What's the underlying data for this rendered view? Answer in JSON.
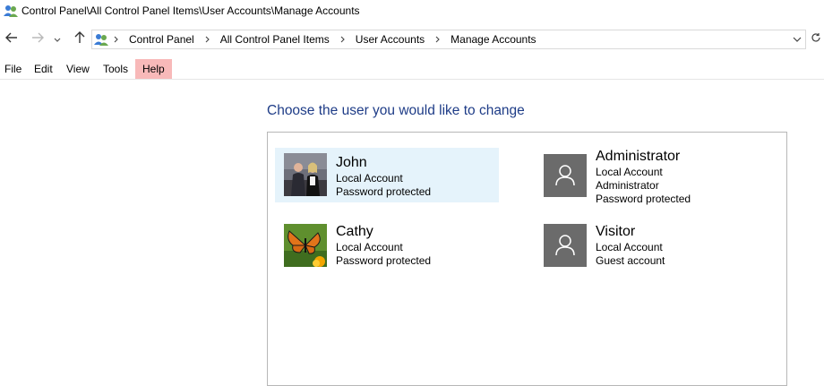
{
  "window": {
    "title": "Control Panel\\All Control Panel Items\\User Accounts\\Manage Accounts",
    "icon": "users-icon"
  },
  "nav": {
    "back_icon": "back-arrow-icon",
    "forward_icon": "forward-arrow-icon",
    "recent_icon": "chevron-down-icon",
    "up_icon": "up-arrow-icon",
    "refresh_icon": "refresh-icon"
  },
  "address": {
    "crumbs": [
      "Control Panel",
      "All Control Panel Items",
      "User Accounts",
      "Manage Accounts"
    ]
  },
  "menu": {
    "items": [
      "File",
      "Edit",
      "View",
      "Tools",
      "Help"
    ],
    "active": "Help"
  },
  "main": {
    "heading": "Choose the user you would like to change",
    "accounts": [
      {
        "name": "John",
        "lines": [
          "Local Account",
          "Password protected"
        ],
        "avatar": "photo",
        "selected": true
      },
      {
        "name": "Administrator",
        "lines": [
          "Local Account",
          "Administrator",
          "Password protected"
        ],
        "avatar": "generic-user-icon",
        "selected": false
      },
      {
        "name": "Cathy",
        "lines": [
          "Local Account",
          "Password protected"
        ],
        "avatar": "butterfly-photo",
        "selected": false
      },
      {
        "name": "Visitor",
        "lines": [
          "Local Account",
          "Guest account"
        ],
        "avatar": "generic-user-icon",
        "selected": false
      }
    ]
  },
  "colors": {
    "heading": "#1e3c87",
    "selection": "#e5f3fb",
    "menu_highlight": "#f8b9b9",
    "generic_avatar": "#6b6b6b"
  }
}
